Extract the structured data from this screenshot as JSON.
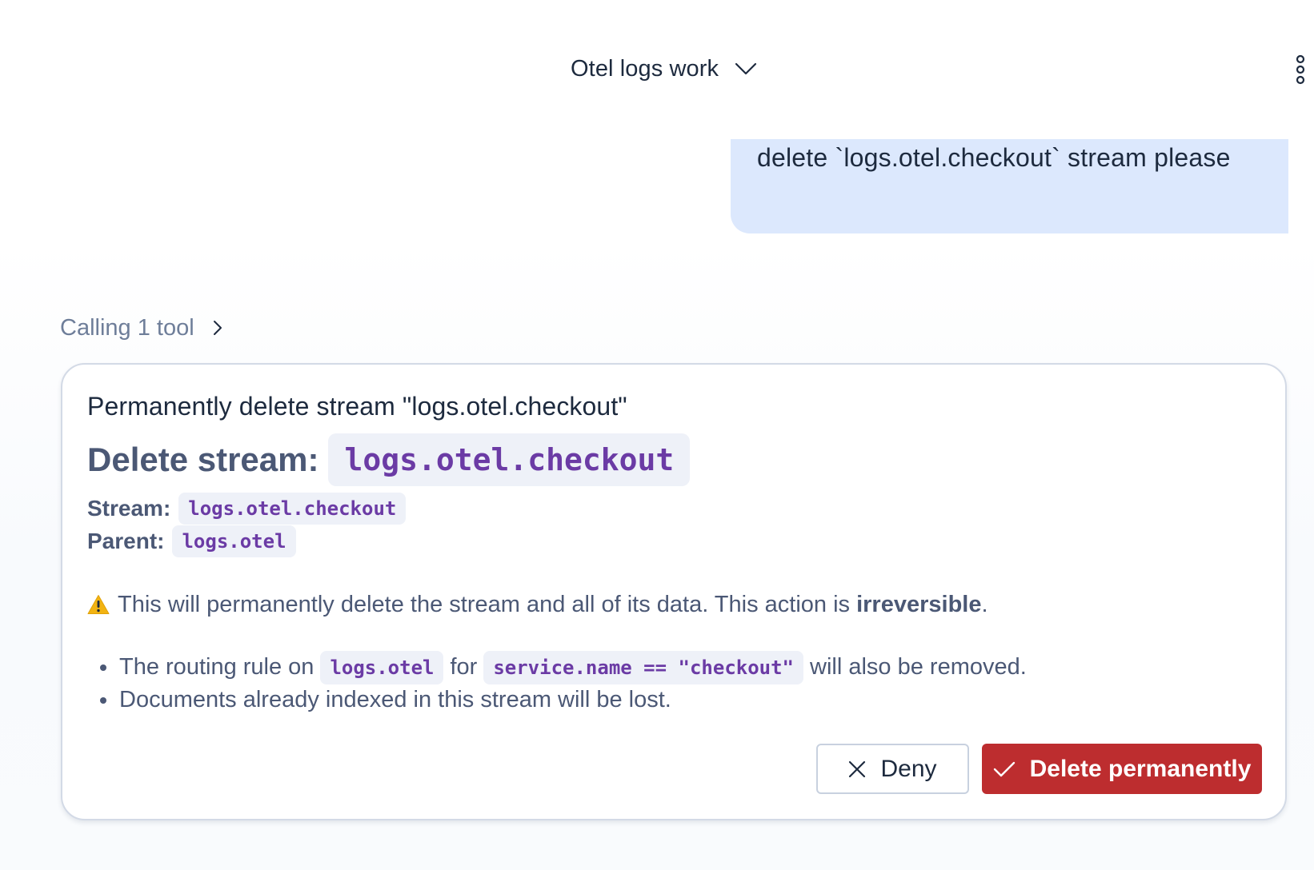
{
  "header": {
    "conversation_title": "Otel logs work",
    "title_dropdown_icon": "chevron-down-icon",
    "more_icon": "vertical-ellipsis-icon"
  },
  "user_message": {
    "text": "delete `logs.otel.checkout` stream please"
  },
  "tool_call": {
    "label": "Calling 1 tool",
    "expand_icon": "chevron-right-icon"
  },
  "confirmation": {
    "title": "Permanently delete stream \"logs.otel.checkout\"",
    "heading_label": "Delete stream:",
    "heading_code": "logs.otel.checkout",
    "stream_label": "Stream:",
    "stream_value": "logs.otel.checkout",
    "parent_label": "Parent:",
    "parent_value": "logs.otel",
    "warning_icon": "warning-icon",
    "warning_text_prefix": "This will permanently delete the stream and all of its data. This action is ",
    "warning_text_bold": "irreversible",
    "warning_text_suffix": ".",
    "bullets": {
      "first": {
        "part1": "The routing rule on",
        "code1": "logs.otel",
        "part2": "for",
        "code2": "service.name == \"checkout\"",
        "part3": "will also be removed."
      },
      "second": {
        "text": "Documents already indexed in this stream will be lost."
      }
    },
    "deny_label": "Deny",
    "deny_icon": "close-icon",
    "confirm_label": "Delete permanently",
    "confirm_icon": "check-icon"
  },
  "colors": {
    "user_bubble": "#dce8fd",
    "danger": "#bd2d2f",
    "code_text": "#6b3ba5",
    "code_bg": "#eef1f8",
    "muted_text": "#6e7e99",
    "warning": "#f2b312"
  }
}
